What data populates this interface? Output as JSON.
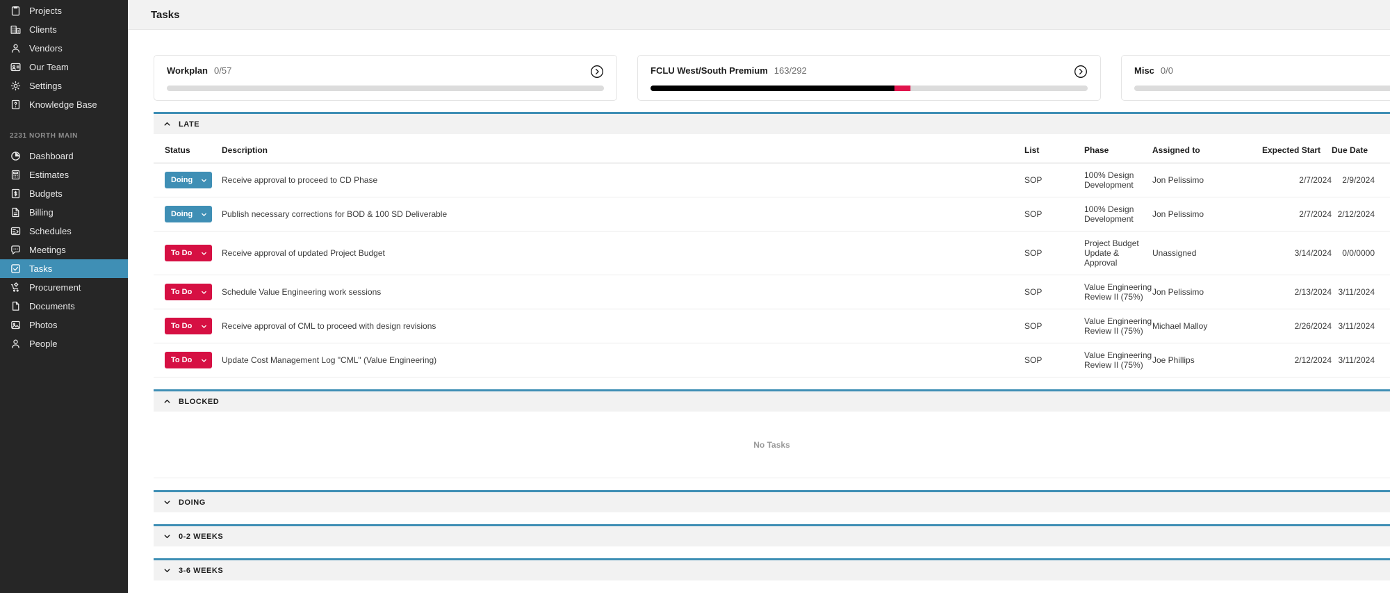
{
  "sidebar": {
    "global_items": [
      {
        "label": "Projects",
        "icon": "clipboard-icon"
      },
      {
        "label": "Clients",
        "icon": "building-icon"
      },
      {
        "label": "Vendors",
        "icon": "vendor-person-icon"
      },
      {
        "label": "Our Team",
        "icon": "id-badge-icon"
      },
      {
        "label": "Settings",
        "icon": "gear-icon"
      },
      {
        "label": "Knowledge Base",
        "icon": "question-book-icon"
      }
    ],
    "project_label": "2231 NORTH MAIN",
    "project_items": [
      {
        "label": "Dashboard",
        "icon": "pie-chart-icon",
        "active": false
      },
      {
        "label": "Estimates",
        "icon": "calculator-icon",
        "active": false
      },
      {
        "label": "Budgets",
        "icon": "dollar-icon",
        "active": false
      },
      {
        "label": "Billing",
        "icon": "document-icon",
        "active": false
      },
      {
        "label": "Schedules",
        "icon": "schedule-icon",
        "active": false
      },
      {
        "label": "Meetings",
        "icon": "chat-icon",
        "active": false
      },
      {
        "label": "Tasks",
        "icon": "checkbox-icon",
        "active": true
      },
      {
        "label": "Procurement",
        "icon": "cart-gear-icon",
        "active": false
      },
      {
        "label": "Documents",
        "icon": "file-icon",
        "active": false
      },
      {
        "label": "Photos",
        "icon": "photo-icon",
        "active": false
      },
      {
        "label": "People",
        "icon": "person-icon",
        "active": false
      }
    ],
    "active_color": "#3f8fb5",
    "background": "#262626"
  },
  "header": {
    "title": "Tasks"
  },
  "cards": [
    {
      "title": "Workplan",
      "count": "0/57",
      "progress_pct": 0,
      "accent_pct": 0
    },
    {
      "title": "FCLU West/South Premium",
      "count": "163/292",
      "progress_pct": 55.8,
      "accent_pct": 3.6
    },
    {
      "title": "Misc",
      "count": "0/0",
      "progress_pct": 0,
      "accent_pct": 0
    }
  ],
  "table": {
    "columns": [
      "Status",
      "Description",
      "List",
      "Phase",
      "Assigned to",
      "Expected Start",
      "Due Date"
    ]
  },
  "sections": [
    {
      "name": "LATE",
      "expanded": true,
      "has_table": true,
      "empty_text": ""
    },
    {
      "name": "BLOCKED",
      "expanded": true,
      "has_table": false,
      "empty_text": "No Tasks"
    },
    {
      "name": "DOING",
      "expanded": false,
      "has_table": false,
      "empty_text": ""
    },
    {
      "name": "0-2 WEEKS",
      "expanded": false,
      "has_table": false,
      "empty_text": ""
    },
    {
      "name": "3-6 WEEKS",
      "expanded": false,
      "has_table": false,
      "empty_text": ""
    }
  ],
  "late_rows": [
    {
      "status": "Doing",
      "status_kind": "doing",
      "description": "Receive approval to proceed to CD Phase",
      "list": "SOP",
      "phase": "100% Design Development",
      "assigned": "Jon Pelissimo",
      "expected_start": "2/7/2024",
      "due_date": "2/9/2024",
      "due_muted": false
    },
    {
      "status": "Doing",
      "status_kind": "doing",
      "description": "Publish necessary corrections for BOD & 100 SD Deliverable",
      "list": "SOP",
      "phase": "100% Design Development",
      "assigned": "Jon Pelissimo",
      "expected_start": "2/7/2024",
      "due_date": "2/12/2024",
      "due_muted": false
    },
    {
      "status": "To Do",
      "status_kind": "todo",
      "description": "Receive approval of updated Project Budget",
      "list": "SOP",
      "phase": "Project Budget Update & Approval",
      "assigned": "Unassigned",
      "expected_start": "3/14/2024",
      "due_date": "0/0/0000",
      "due_muted": true
    },
    {
      "status": "To Do",
      "status_kind": "todo",
      "description": "Schedule Value Engineering work sessions",
      "list": "SOP",
      "phase": "Value Engineering Review II (75%)",
      "assigned": "Jon Pelissimo",
      "expected_start": "2/13/2024",
      "due_date": "3/11/2024",
      "due_muted": false
    },
    {
      "status": "To Do",
      "status_kind": "todo",
      "description": "Receive approval of CML to proceed with design revisions",
      "list": "SOP",
      "phase": "Value Engineering Review II (75%)",
      "assigned": "Michael Malloy",
      "expected_start": "2/26/2024",
      "due_date": "3/11/2024",
      "due_muted": false
    },
    {
      "status": "To Do",
      "status_kind": "todo",
      "description": "Update Cost Management Log \"CML\" (Value Engineering)",
      "list": "SOP",
      "phase": "Value Engineering Review II (75%)",
      "assigned": "Joe Phillips",
      "expected_start": "2/12/2024",
      "due_date": "3/11/2024",
      "due_muted": false
    }
  ],
  "colors": {
    "accent_blue": "#3f8fb5",
    "status_todo_red": "#d61043",
    "progress_pink": "#e0144c",
    "progress_black": "#000000",
    "sidebar_bg": "#262626",
    "topbar_bg": "#f2f2f2"
  }
}
